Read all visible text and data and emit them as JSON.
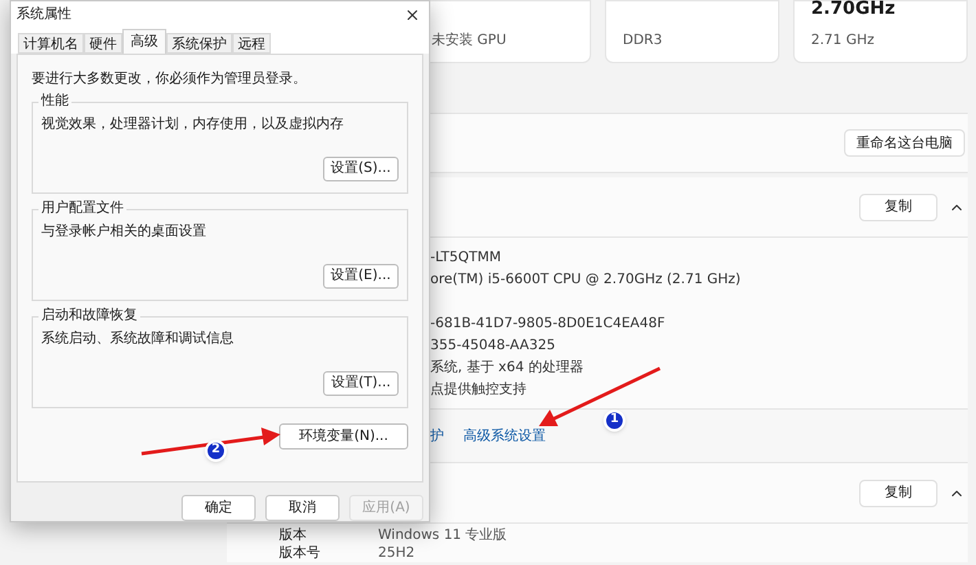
{
  "settings_page": {
    "cards": [
      {
        "detail": "未安装 GPU"
      },
      {
        "detail": "DDR3"
      },
      {
        "value": "2.70GHz",
        "detail": "2.71 GHz"
      }
    ],
    "rename_button": "重命名这台电脑",
    "device_section": {
      "copy_button": "复制",
      "expanded": true,
      "spec_lines": [
        "-LT5QTMM",
        "ore(TM) i5-6600T CPU @ 2.70GHz (2.71 GHz)"
      ],
      "id_lines": [
        "-681B-41D7-9805-8D0E1C4EA48F",
        "355-45048-AA325",
        "系统, 基于 x64 的处理器",
        "点提供触控支持"
      ],
      "related_links": [
        "护",
        "高级系统设置"
      ]
    },
    "windows_section": {
      "copy_button": "复制",
      "expanded": true,
      "rows": [
        {
          "label": "版本",
          "value": "Windows 11 专业版"
        },
        {
          "label": "版本号",
          "value": "25H2"
        }
      ]
    }
  },
  "dialog": {
    "title": "系统属性",
    "tabs": [
      {
        "label": "计算机名",
        "selected": false
      },
      {
        "label": "硬件",
        "selected": false
      },
      {
        "label": "高级",
        "selected": true
      },
      {
        "label": "系统保护",
        "selected": false
      },
      {
        "label": "远程",
        "selected": false
      }
    ],
    "notice": "要进行大多数更改，你必须作为管理员登录。",
    "groups": [
      {
        "title": "性能",
        "description": "视觉效果，处理器计划，内存使用，以及虚拟内存",
        "button": "设置(S)..."
      },
      {
        "title": "用户配置文件",
        "description": "与登录帐户相关的桌面设置",
        "button": "设置(E)..."
      },
      {
        "title": "启动和故障恢复",
        "description": "系统启动、系统故障和调试信息",
        "button": "设置(T)..."
      }
    ],
    "env_button": "环境变量(N)...",
    "footer_buttons": [
      {
        "label": "确定",
        "disabled": false
      },
      {
        "label": "取消",
        "disabled": false
      },
      {
        "label": "应用(A)",
        "disabled": true
      }
    ]
  },
  "annotations": [
    {
      "number": "1"
    },
    {
      "number": "2"
    }
  ]
}
